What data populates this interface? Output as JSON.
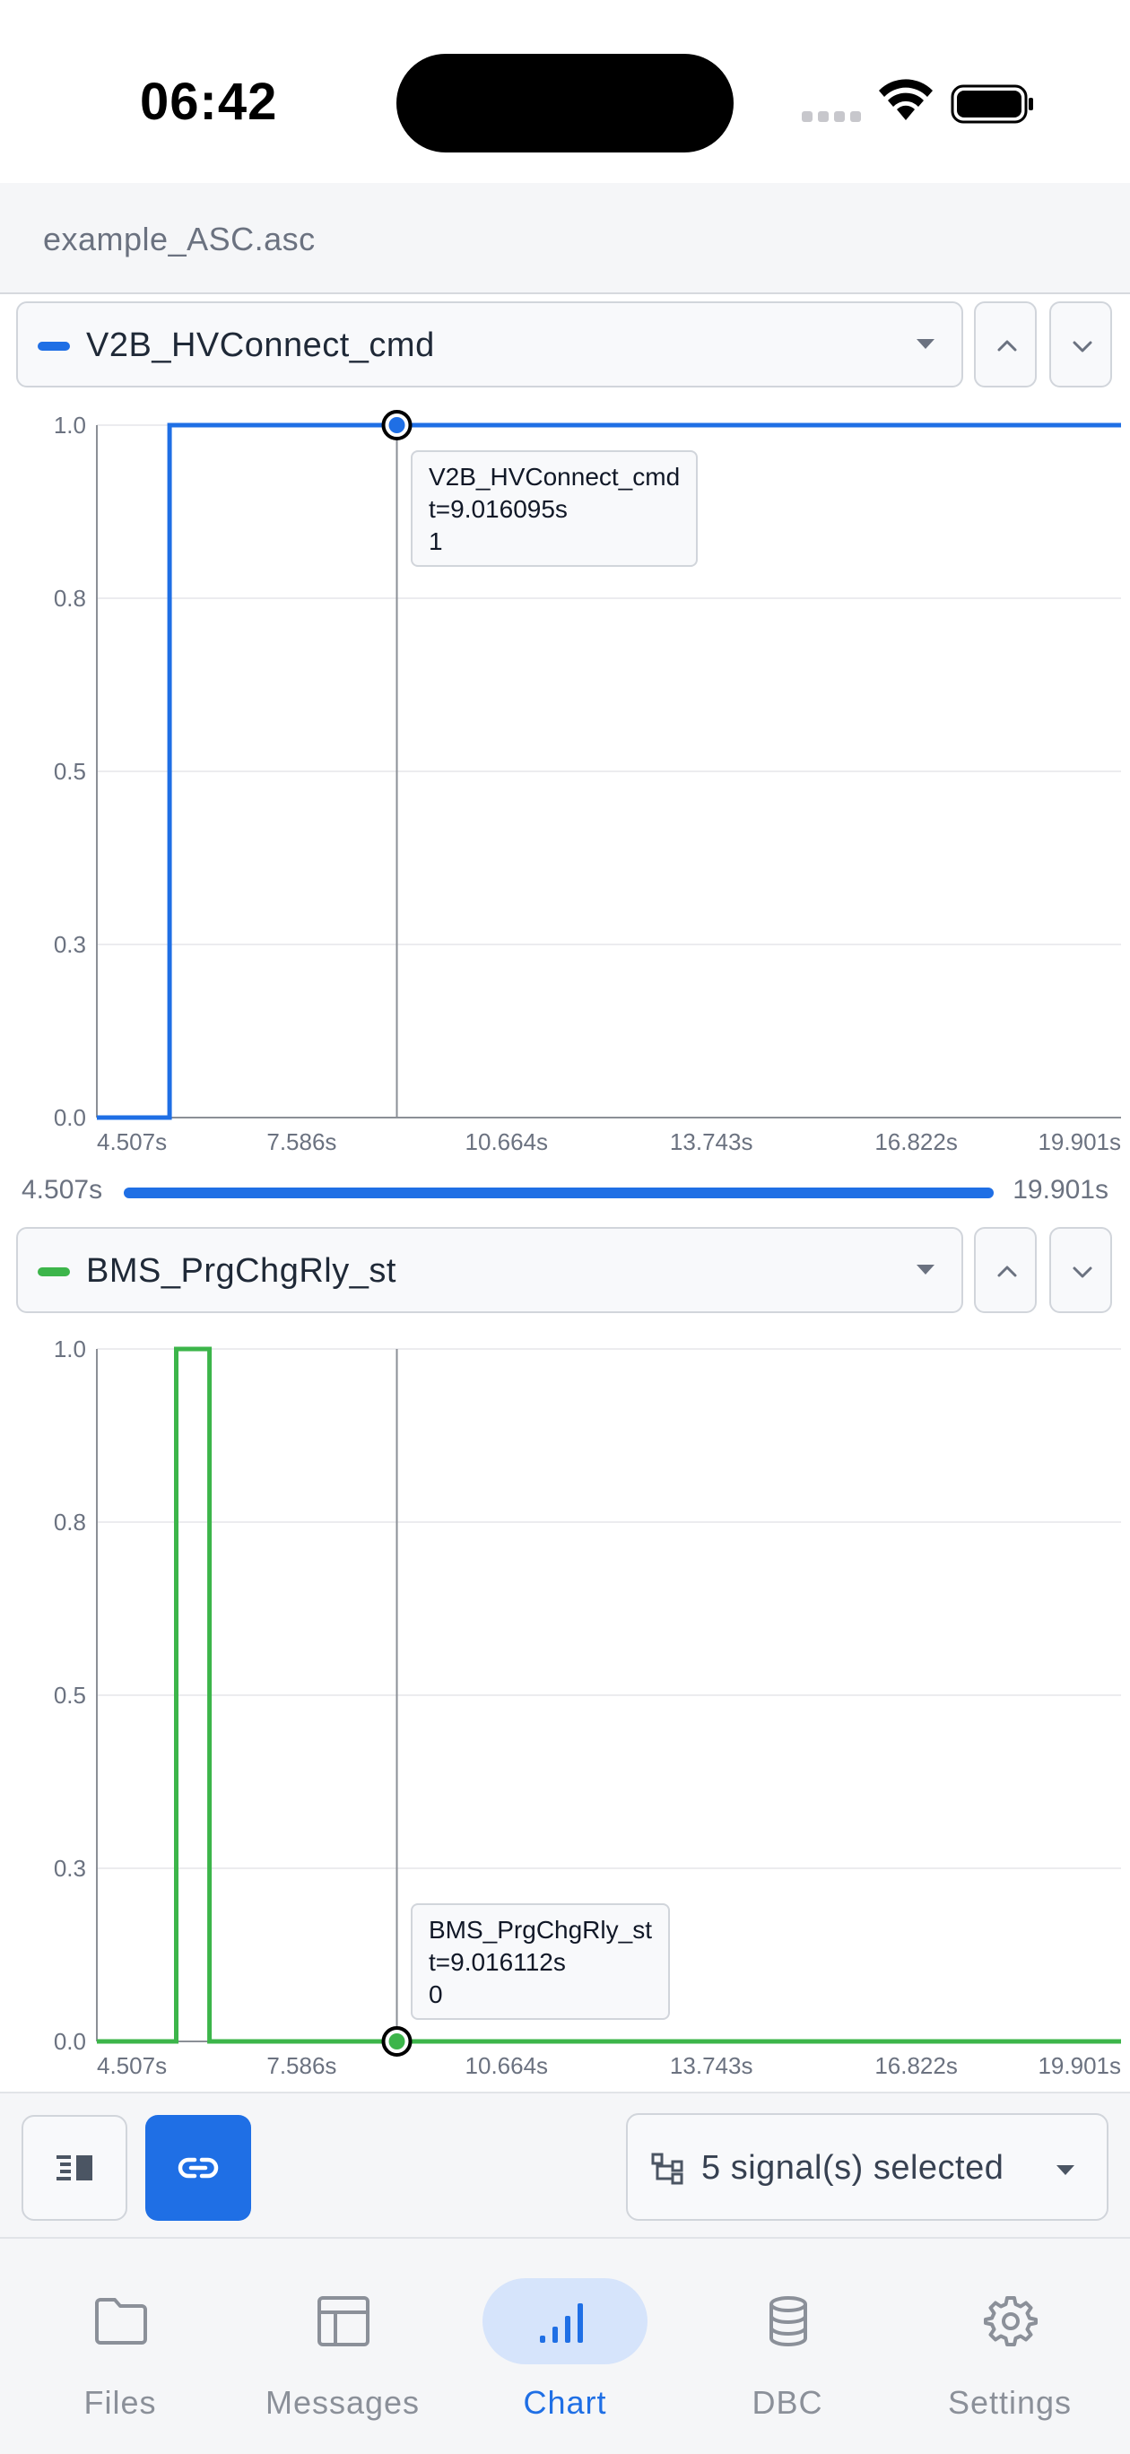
{
  "status_bar": {
    "time": "06:42"
  },
  "file": {
    "name": "example_ASC.asc"
  },
  "chart_data": [
    {
      "type": "line",
      "signal": "V2B_HVConnect_cmd",
      "color": "#1f6fe5",
      "xlim": [
        4.507,
        19.901
      ],
      "ylim": [
        0,
        1
      ],
      "x_ticks": [
        "4.507s",
        "7.586s",
        "10.664s",
        "13.743s",
        "16.822s",
        "19.901s"
      ],
      "y_ticks": [
        "0.0",
        "0.3",
        "0.5",
        "0.8",
        "1.0"
      ],
      "series": [
        {
          "x": [
            4.507,
            5.6,
            5.6,
            19.901
          ],
          "y": [
            0,
            0,
            1,
            1
          ]
        }
      ],
      "cursor": {
        "t": 9.016095,
        "value": 1
      },
      "tooltip": {
        "name": "V2B_HVConnect_cmd",
        "time": "t=9.016095s",
        "value": "1"
      }
    },
    {
      "type": "line",
      "signal": "BMS_PrgChgRly_st",
      "color": "#3cb54a",
      "xlim": [
        4.507,
        19.901
      ],
      "ylim": [
        0,
        1
      ],
      "x_ticks": [
        "4.507s",
        "7.586s",
        "10.664s",
        "13.743s",
        "16.822s",
        "19.901s"
      ],
      "y_ticks": [
        "0.0",
        "0.3",
        "0.5",
        "0.8",
        "1.0"
      ],
      "series": [
        {
          "x": [
            4.507,
            5.7,
            5.7,
            6.2,
            6.2,
            19.901
          ],
          "y": [
            0,
            0,
            1,
            1,
            0,
            0
          ]
        }
      ],
      "cursor": {
        "t": 9.016112,
        "value": 0
      },
      "tooltip": {
        "name": "BMS_PrgChgRly_st",
        "time": "t=9.016112s",
        "value": "0"
      }
    }
  ],
  "range": {
    "start": "4.507s",
    "end": "19.901s",
    "fill_fraction": 1.0
  },
  "toolbar": {
    "signals_selected": "5 signal(s) selected"
  },
  "tabs": [
    {
      "label": "Files",
      "icon": "folder-icon"
    },
    {
      "label": "Messages",
      "icon": "table-icon"
    },
    {
      "label": "Chart",
      "icon": "chart-bars-icon",
      "active": true
    },
    {
      "label": "DBC",
      "icon": "database-icon"
    },
    {
      "label": "Settings",
      "icon": "gear-icon"
    }
  ]
}
